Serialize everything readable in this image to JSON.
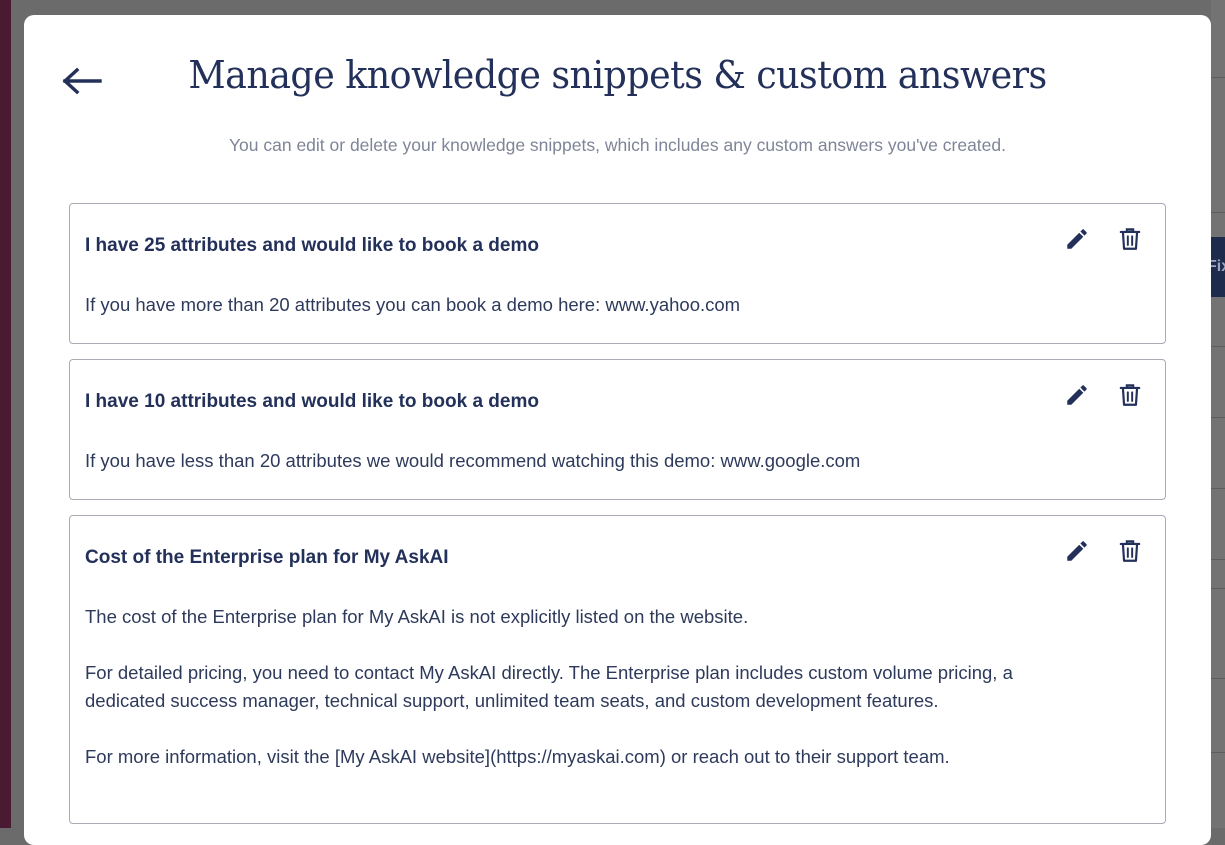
{
  "colors": {
    "primary": "#23305a",
    "subtitle": "#7f8597",
    "card_border": "#a9acb5",
    "overlay": "#6b6b6b",
    "left_strip": "#4a1a33"
  },
  "header": {
    "back_icon": "arrow-left-icon",
    "title": "Manage knowledge snippets & custom answers",
    "subtitle": "You can edit or delete your knowledge snippets, which includes any custom answers you've created."
  },
  "background": {
    "partial_button_text": "Fix"
  },
  "snippets": [
    {
      "title": "I have 25 attributes and would like to book a demo",
      "paragraphs": [
        "If you have more than 20 attributes you can book a demo here: www.yahoo.com"
      ],
      "edit_icon": "pencil-icon",
      "delete_icon": "trash-icon"
    },
    {
      "title": "I have 10 attributes and would like to book a demo",
      "paragraphs": [
        "If you have less than 20 attributes we would recommend watching this demo: www.google.com"
      ],
      "edit_icon": "pencil-icon",
      "delete_icon": "trash-icon"
    },
    {
      "title": "Cost of the Enterprise plan for My AskAI",
      "paragraphs": [
        "The cost of the Enterprise plan for My AskAI is not explicitly listed on the website.",
        "For detailed pricing, you need to contact My AskAI directly. The Enterprise plan includes custom volume pricing, a dedicated success manager, technical support, unlimited team seats, and custom development features.",
        "For more information, visit the [My AskAI website](https://myaskai.com) or reach out to their support team."
      ],
      "edit_icon": "pencil-icon",
      "delete_icon": "trash-icon"
    }
  ]
}
